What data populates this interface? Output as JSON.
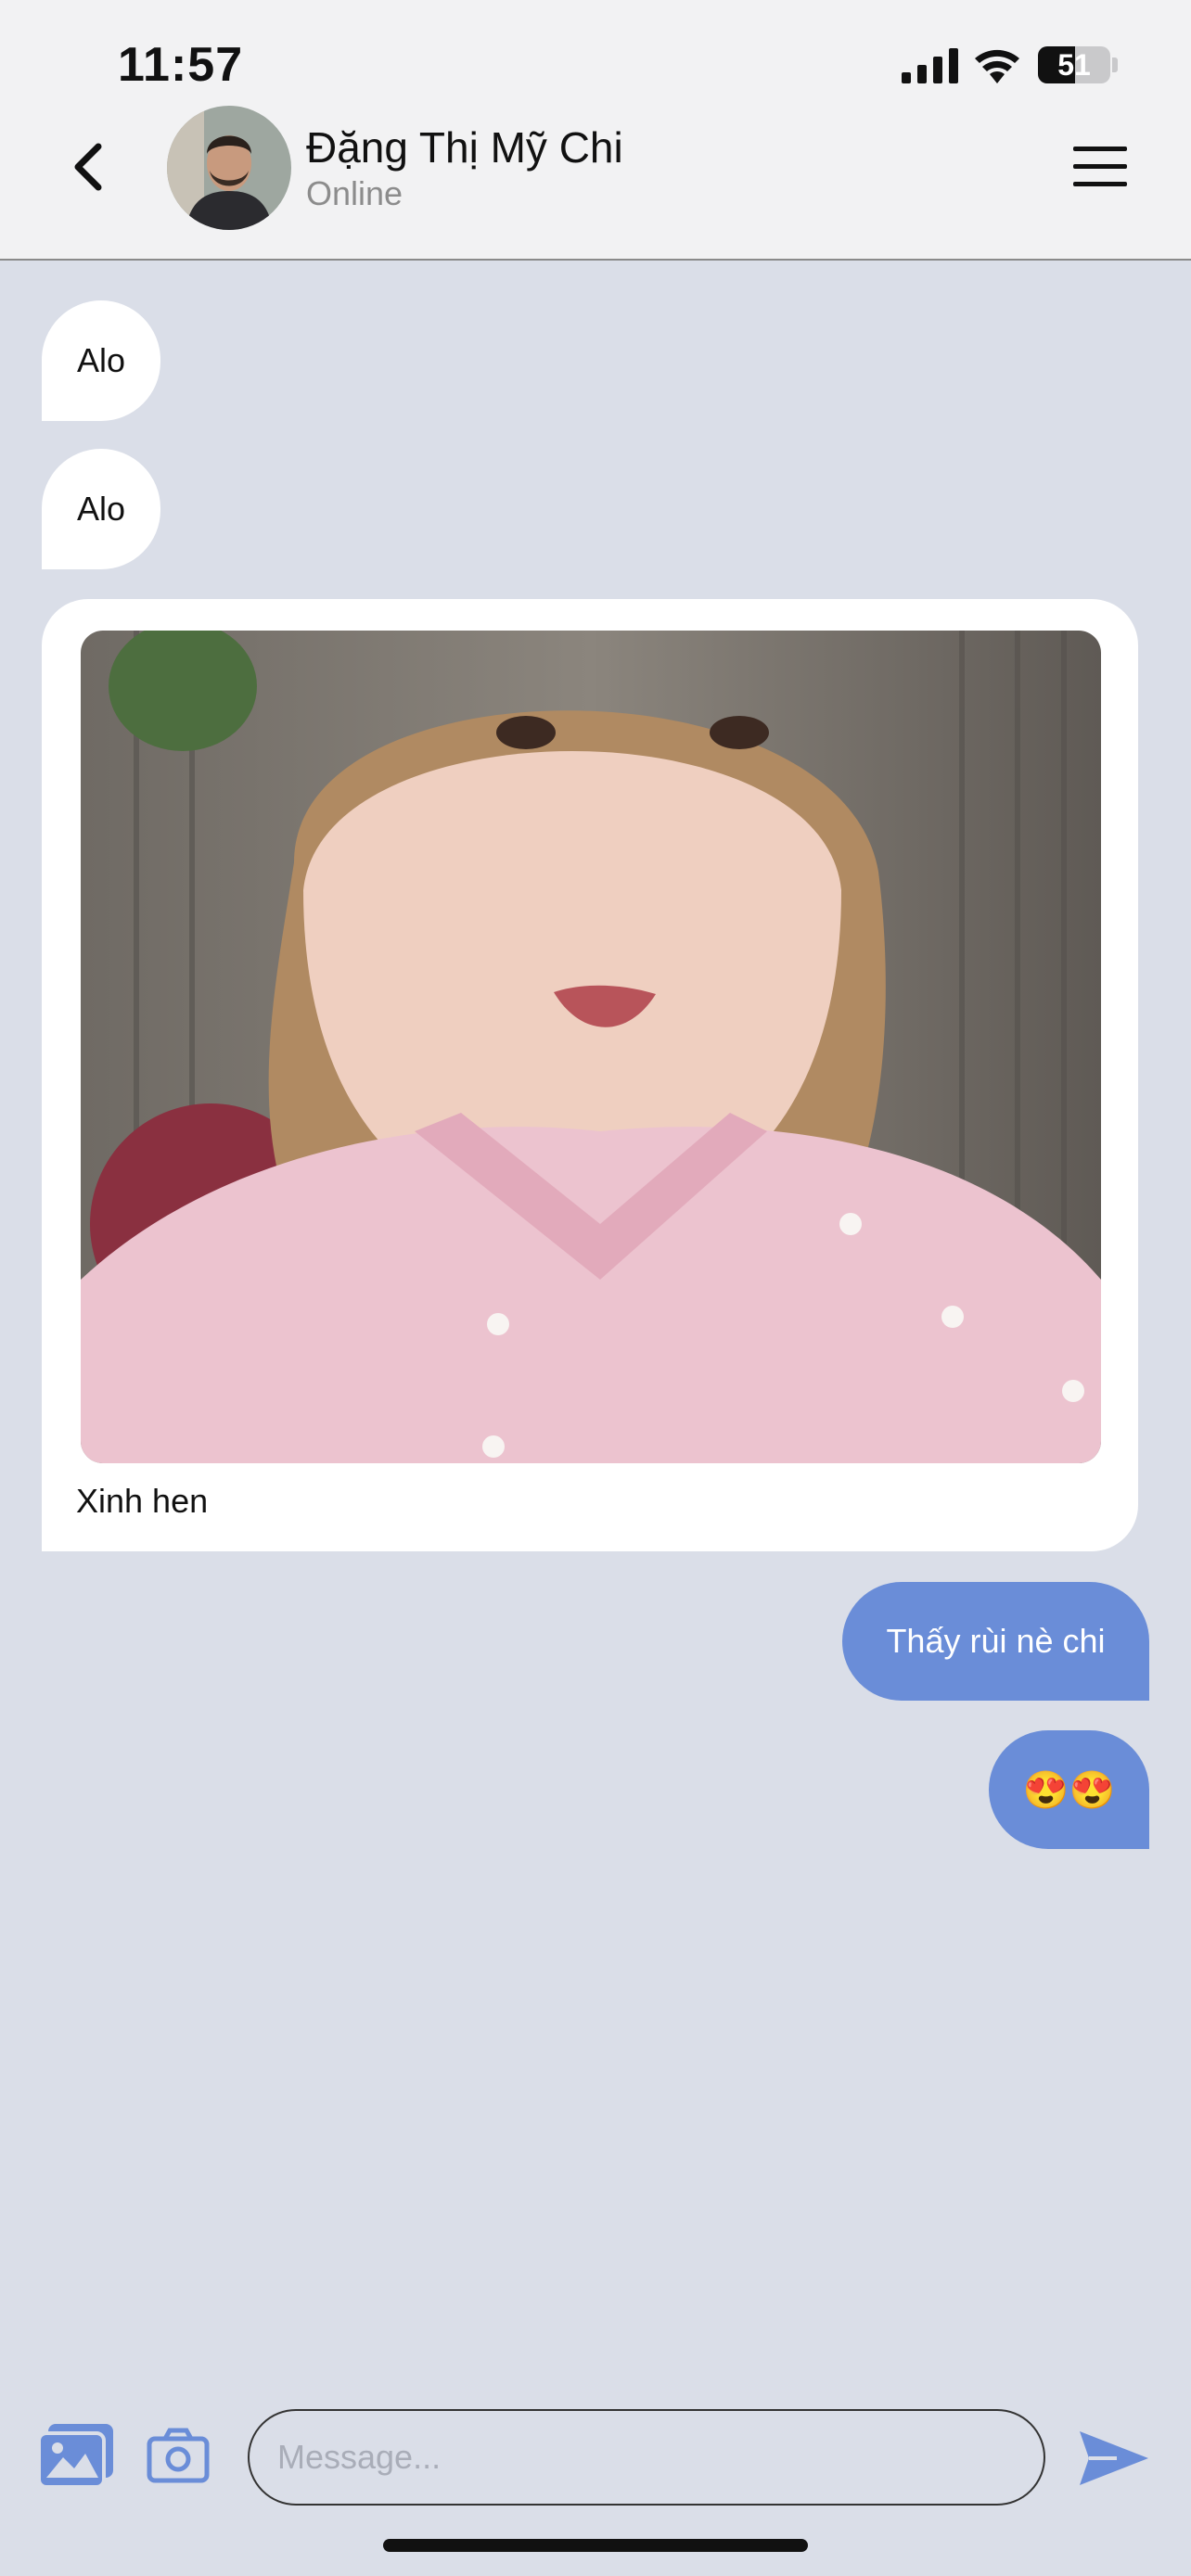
{
  "status_bar": {
    "time": "11:57",
    "battery": "51"
  },
  "header": {
    "contact_name": "Đặng Thị Mỹ Chi",
    "presence": "Online"
  },
  "messages": [
    {
      "direction": "in",
      "text": "Alo"
    },
    {
      "direction": "in",
      "text": "Alo"
    },
    {
      "direction": "in",
      "type": "photo",
      "caption": "Xinh hen"
    },
    {
      "direction": "out",
      "text": "Thấy rùi nè chi"
    },
    {
      "direction": "out",
      "text": "😍😍"
    }
  ],
  "composer": {
    "placeholder": "Message..."
  },
  "colors": {
    "accent": "#6a8dd8",
    "chat_bg": "#dadee8",
    "header_bg": "#f2f2f3"
  }
}
